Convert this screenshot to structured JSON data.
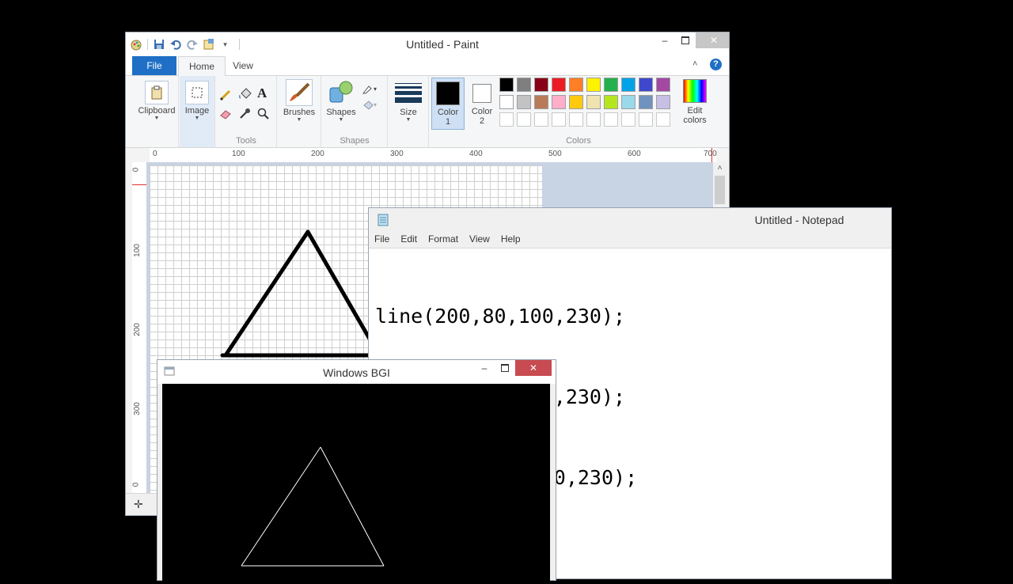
{
  "paint": {
    "title": "Untitled - Paint",
    "tabs": {
      "file": "File",
      "home": "Home",
      "view": "View"
    },
    "ribbon": {
      "clipboard": "Clipboard",
      "image": "Image",
      "tools": "Tools",
      "brushes": "Brushes",
      "shapes": "Shapes",
      "size": "Size",
      "color1_line1": "Color",
      "color1_line2": "1",
      "color2_line1": "Color",
      "color2_line2": "2",
      "edit_colors_line1": "Edit",
      "edit_colors_line2": "colors",
      "colors": "Colors",
      "group_shapes": "Shapes"
    },
    "palette_row1": [
      "#000000",
      "#7f7f7f",
      "#880015",
      "#ed1c24",
      "#ff7f27",
      "#fff200",
      "#22b14c",
      "#00a2e8",
      "#3f48cc",
      "#a349a4"
    ],
    "palette_row2": [
      "#ffffff",
      "#c3c3c3",
      "#b97a57",
      "#ffaec9",
      "#ffc90e",
      "#efe4b0",
      "#b5e61d",
      "#99d9ea",
      "#7092be",
      "#c8bfe7"
    ],
    "ruler_h": [
      "0",
      "100",
      "200",
      "300",
      "400",
      "500",
      "600",
      "700"
    ],
    "ruler_v": [
      "0",
      "100",
      "200",
      "300",
      "0"
    ]
  },
  "notepad": {
    "title": "Untitled - Notepad",
    "menu": [
      "File",
      "Edit",
      "Format",
      "View",
      "Help"
    ],
    "lines": [
      "line(200,80,100,230);",
      "line(200,80,280,230);",
      "line(280,230,100,230);"
    ]
  },
  "bgi": {
    "title": "Windows BGI"
  }
}
